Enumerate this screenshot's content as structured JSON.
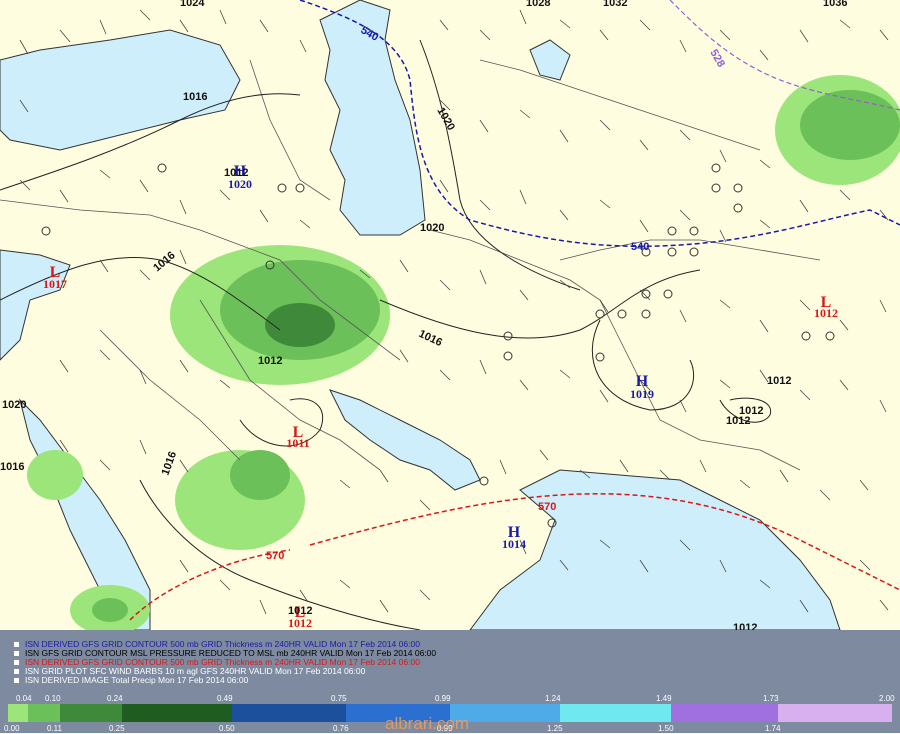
{
  "legend": [
    {
      "text": "ISN DERIVED GFS GRID CONTOUR 500 mb GRID Thickness m 240HR VALID Mon 17 Feb 2014 06:00",
      "color": "#1a1aa8"
    },
    {
      "text": "ISN GFS GRID CONTOUR MSL PRESSURE REDUCED TO MSL mb 240HR VALID Mon 17 Feb 2014 06:00",
      "color": "#000000"
    },
    {
      "text": "ISN DERIVED GFS GRID CONTOUR 500 mb GRID Thickness m 240HR VALID Mon 17 Feb 2014 06:00",
      "color": "#d81818"
    },
    {
      "text": "ISN GRID PLOT SFC WIND BARBS 10 m agl GFS 240HR VALID Mon 17 Feb 2014 06:00",
      "color": "#ffffff"
    },
    {
      "text": "ISN DERIVED IMAGE Total Precip Mon 17 Feb 2014 06:00",
      "color": "#ffffff"
    }
  ],
  "colorbar": {
    "top_labels": [
      "0.04",
      "0.10",
      "0.24",
      "0.49",
      "0.75",
      "0.99",
      "1.24",
      "1.49",
      "1.73",
      "2.00"
    ],
    "bottom_labels": [
      "0.00",
      "0.11",
      "0.25",
      "0.50",
      "0.76",
      "0.99",
      "1.25",
      "1.50",
      "1.74"
    ],
    "colors": [
      "#9ce57a",
      "#6cc05a",
      "#3e8a3a",
      "#1f5c1f",
      "#1c4f9c",
      "#2b6fd0",
      "#4faae8",
      "#6fe8f0",
      "#a070e0",
      "#d8b0f0"
    ]
  },
  "watermark": "albrari.com",
  "pressure_centers": [
    {
      "type": "L",
      "value": "1017",
      "color": "#d81818"
    },
    {
      "type": "H",
      "value": "1020",
      "color": "#1a1aa8"
    },
    {
      "type": "L",
      "value": "1011",
      "color": "#d81818"
    },
    {
      "type": "H",
      "value": "1019",
      "color": "#1a1aa8"
    },
    {
      "type": "H",
      "value": "1014",
      "color": "#1a1aa8"
    },
    {
      "type": "L",
      "value": "1012",
      "color": "#d81818"
    },
    {
      "type": "L",
      "value": "1012",
      "color": "#d81818"
    }
  ],
  "isobar_labels": [
    "1016",
    "1020",
    "1024",
    "1028",
    "1032",
    "1036",
    "1016",
    "1020",
    "1012",
    "1016",
    "1020",
    "1016",
    "1012",
    "1012",
    "1012",
    "1012",
    "1012",
    "1012",
    "1016"
  ],
  "thickness_labels": [
    {
      "value": "540",
      "color": "#1a1aa8"
    },
    {
      "value": "540",
      "color": "#1a1aa8"
    },
    {
      "value": "528",
      "color": "#9060d0"
    },
    {
      "value": "570",
      "color": "#d81818"
    },
    {
      "value": "570",
      "color": "#d81818"
    }
  ]
}
